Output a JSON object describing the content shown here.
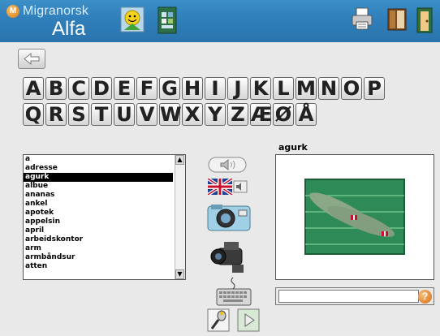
{
  "header": {
    "logo_badge": "M",
    "brand": "Migranorsk",
    "product": "Alfa",
    "icons": [
      "smiley-icon",
      "book-cover-icon",
      "printer-icon",
      "book-icon",
      "exit-door-icon"
    ]
  },
  "navigation": {
    "back_icon": "arrow-left-icon"
  },
  "alphabet": {
    "row1": [
      "A",
      "B",
      "C",
      "D",
      "E",
      "F",
      "G",
      "H",
      "I",
      "J",
      "K",
      "L",
      "M",
      "N",
      "O",
      "P"
    ],
    "row2": [
      "Q",
      "R",
      "S",
      "T",
      "U",
      "V",
      "W",
      "X",
      "Y",
      "Z",
      "Æ",
      "Ø",
      "Å"
    ]
  },
  "word_list": {
    "items": [
      "a",
      "adresse",
      "agurk",
      "albue",
      "ananas",
      "ankel",
      "apotek",
      "appelsin",
      "april",
      "arbeidskontor",
      "arm",
      "armbåndsur",
      "atten"
    ],
    "selected": "agurk"
  },
  "media_buttons": [
    "speaker-button",
    "english-flag-button",
    "camera-button",
    "video-camera-button",
    "keyboard-button"
  ],
  "display": {
    "word": "agurk",
    "image_subject": "cucumbers in green crate"
  },
  "answer": {
    "value": "",
    "help_symbol": "?"
  },
  "bottom_buttons": [
    "microphone-button",
    "play-button"
  ],
  "colors": {
    "header_blue": "#2f7fba",
    "selection": "#000000",
    "help_orange": "#d56a12"
  }
}
